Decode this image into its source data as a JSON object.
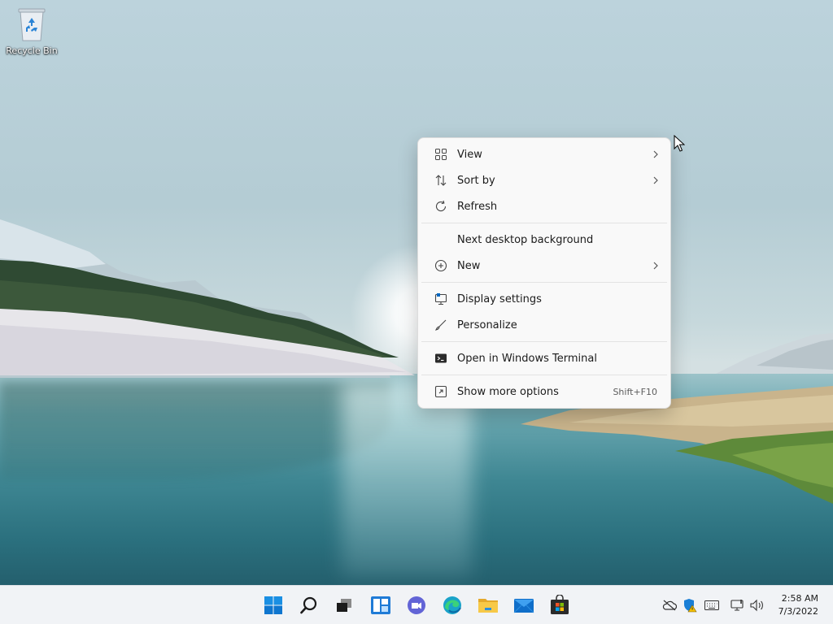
{
  "desktop": {
    "icons": [
      {
        "label": "Recycle Bin",
        "icon": "recycle-bin-icon"
      }
    ]
  },
  "context_menu": {
    "items": [
      {
        "label": "View",
        "icon": "grid-icon",
        "submenu": true
      },
      {
        "label": "Sort by",
        "icon": "sort-icon",
        "submenu": true
      },
      {
        "label": "Refresh",
        "icon": "refresh-icon",
        "submenu": false
      },
      {
        "label": "Next desktop background",
        "icon": "",
        "submenu": false
      },
      {
        "label": "New",
        "icon": "plus-circle-icon",
        "submenu": true
      },
      {
        "label": "Display settings",
        "icon": "display-icon",
        "submenu": false
      },
      {
        "label": "Personalize",
        "icon": "brush-icon",
        "submenu": false
      },
      {
        "label": "Open in Windows Terminal",
        "icon": "terminal-icon",
        "submenu": false
      },
      {
        "label": "Show more options",
        "icon": "expand-icon",
        "shortcut": "Shift+F10"
      }
    ]
  },
  "taskbar": {
    "apps": [
      "start-icon",
      "search-icon",
      "task-view-icon",
      "widgets-icon",
      "chat-icon",
      "edge-icon",
      "file-explorer-icon",
      "mail-icon",
      "store-icon"
    ],
    "tray": [
      "onedrive-icon",
      "security-icon",
      "keyboard-icon",
      "network-icon",
      "volume-icon"
    ],
    "clock": {
      "time": "2:58 AM",
      "date": "7/3/2022"
    }
  },
  "colors": {
    "accent": "#0067c0",
    "menu_bg": "#f9f9f9",
    "taskbar_bg": "#f1f3f6"
  }
}
